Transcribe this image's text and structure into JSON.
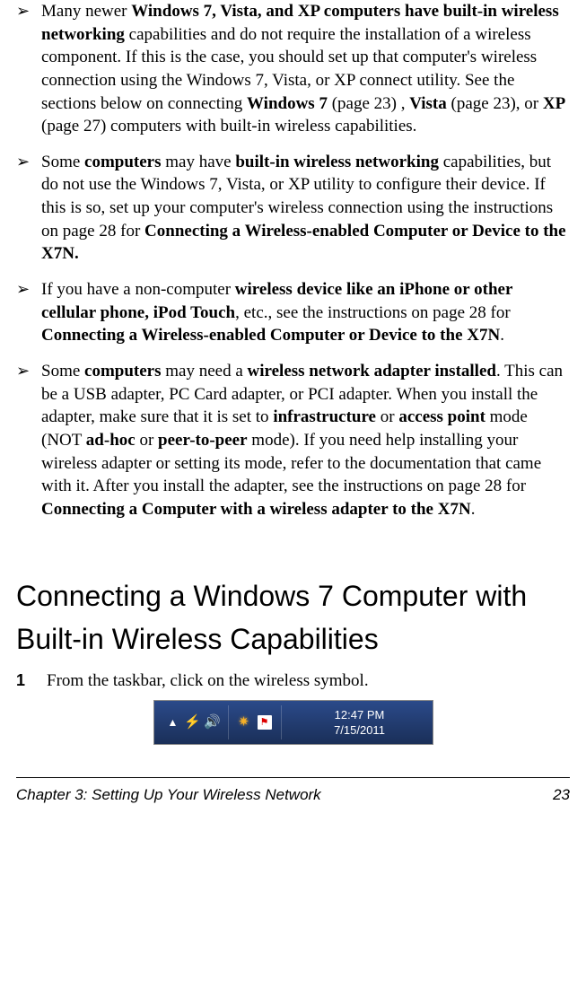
{
  "bullets": [
    {
      "b1a": "Many newer ",
      "b1b": "Windows 7, Vista, and XP computers have built-in wireless networking",
      "b1c": " capabilities and do not require the installation of a wireless component. If this is the case, you should set up that computer's wireless connection using the Windows 7, Vista, or XP connect utility. See the sections below on connecting ",
      "b1d": "Windows 7",
      "b1e": " (page 23) , ",
      "b1f": "Vista",
      "b1g": " (page 23), or ",
      "b1h": "XP",
      "b1i": " (page 27) computers with built-in wireless capabilities."
    },
    {
      "b2a": "Some ",
      "b2b": "computers",
      "b2c": " may have ",
      "b2d": "built-in wireless networking",
      "b2e": " capabilities, but do not use the Windows 7, Vista, or XP utility to configure their device. If this is so, set up your computer's wireless connection using the instructions on page 28 for ",
      "b2f": "Connecting a Wireless-enabled Computer or Device to the X7N."
    },
    {
      "b3a": "If you have a non-computer ",
      "b3b": "wireless device like an iPhone or other cellular phone, iPod Touch",
      "b3c": ", etc., see the instructions on page 28 for ",
      "b3d": "Connecting a Wireless-enabled Computer or Device to the X7N",
      "b3e": "."
    },
    {
      "b4a": "Some ",
      "b4b": "computers",
      "b4c": " may need a ",
      "b4d": "wireless network adapter installed",
      "b4e": ". This can be a USB adapter, PC Card adapter, or PCI adapter. When you install the adapter, make sure that it is set to ",
      "b4f": "infrastructure",
      "b4g": " or ",
      "b4h": "access point",
      "b4i": " mode (NOT ",
      "b4j": "ad-hoc",
      "b4k": " or ",
      "b4l": "peer-to-peer",
      "b4m": " mode). If you need help installing your wireless adapter or setting its mode, refer to the documentation that came with it. After you install the adapter, see the instructions on page 28 for ",
      "b4n": "Connecting a Computer with a wireless adapter to the X7N",
      "b4o": "."
    }
  ],
  "heading": "Connecting a Windows 7 Computer with Built-in Wireless Capabilities",
  "step": {
    "num": "1",
    "text": "From the taskbar, click on the wireless symbol."
  },
  "taskbar": {
    "time": "12:47 PM",
    "date": "7/15/2011"
  },
  "footer": {
    "chapter": "Chapter 3: Setting Up Your Wireless Network",
    "page": "23"
  }
}
